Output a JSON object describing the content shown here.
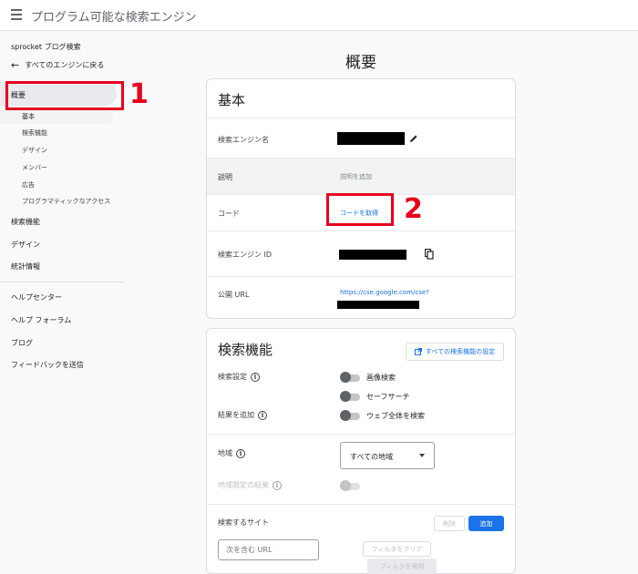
{
  "header": {
    "title": "プログラム可能な検索エンジン"
  },
  "sidebar": {
    "engine_name": "sprocket ブログ検索",
    "back_label": "すべてのエンジンに戻る",
    "active_item": "概要",
    "sub_items": [
      "基本",
      "検索機能",
      "デザイン",
      "メンバー",
      "広告",
      "プログラマティックなアクセス"
    ],
    "items": [
      "検索機能",
      "デザイン",
      "統計情報"
    ],
    "footer_items": [
      "ヘルプセンター",
      "ヘルプ フォーラム",
      "ブログ",
      "フィードバックを送信"
    ]
  },
  "markers": {
    "one": "1",
    "two": "2"
  },
  "main": {
    "heading": "概要",
    "basics": {
      "title": "基本",
      "engine_name_label": "検索エンジン名",
      "description_label": "説明",
      "description_placeholder": "説明を追加",
      "code_label": "コード",
      "code_link": "コードを取得",
      "engine_id_label": "検索エンジン ID",
      "public_url_label": "公開 URL",
      "public_url": "https://cse.google.com/cse?"
    },
    "search_features": {
      "title": "検索機能",
      "all_settings_button": "すべての検索機能の設定",
      "search_settings_label": "検索設定",
      "image_search_label": "画像検索",
      "safe_search_label": "セーフサーチ",
      "add_results_label": "結果を追加",
      "whole_web_label": "ウェブ全体を検索",
      "region_label": "地域",
      "region_value": "すべての地域",
      "region_restricted_label": "地域限定の結果",
      "sites_label": "検索するサイト",
      "delete_button": "削除",
      "add_button": "追加",
      "url_filter_placeholder": "次を含む URL",
      "clear_filter_button": "フィルタをクリア",
      "apply_filter_button": "フィルタを適用"
    }
  },
  "colors": {
    "accent": "#1a73e8",
    "highlight": "#e8001c"
  }
}
